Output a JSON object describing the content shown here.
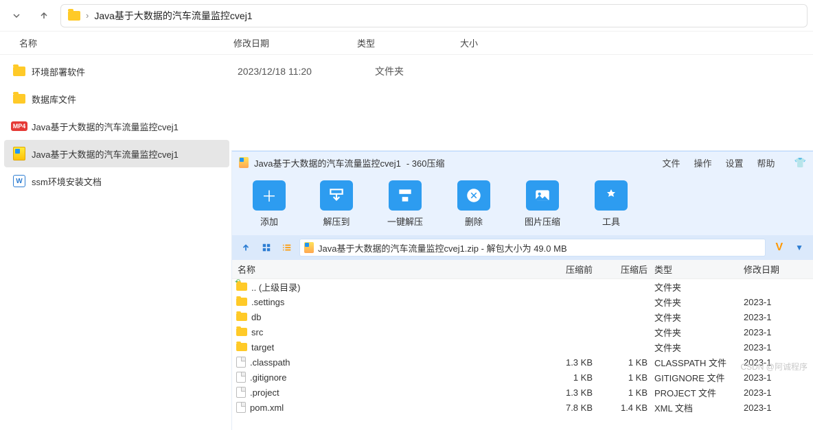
{
  "nav": {
    "path_label": "Java基于大数据的汽车流量监控cvej1"
  },
  "columns": {
    "name": "名称",
    "modified": "修改日期",
    "type": "类型",
    "size": "大小"
  },
  "explorer_rows": [
    {
      "icon": "folder",
      "name": "环境部署软件",
      "date": "2023/12/18 11:20",
      "ftype": "文件夹"
    },
    {
      "icon": "folder",
      "name": "数据库文件"
    },
    {
      "icon": "mp4",
      "name": "Java基于大数据的汽车流量监控cvej1"
    },
    {
      "icon": "zip",
      "name": "Java基于大数据的汽车流量监控cvej1",
      "selected": true
    },
    {
      "icon": "doc",
      "name": "ssm环境安装文档"
    }
  ],
  "zip": {
    "title_prefix": "Java基于大数据的汽车流量监控cvej1",
    "title_suffix": " - 360压缩",
    "menu": {
      "file": "文件",
      "op": "操作",
      "settings": "设置",
      "help": "帮助"
    },
    "toolbar": {
      "add": "添加",
      "extract": "解压到",
      "oneclick": "一键解压",
      "delete": "删除",
      "image": "图片压缩",
      "tools": "工具"
    },
    "path_text": "Java基于大数据的汽车流量监控cvej1.zip - 解包大小为 49.0 MB",
    "headers": {
      "name": "名称",
      "pre": "压缩前",
      "post": "压缩后",
      "type": "类型",
      "date": "修改日期"
    },
    "rows": [
      {
        "icon": "up",
        "name": ".. (上级目录)",
        "pre": "",
        "post": "",
        "type": "文件夹",
        "date": ""
      },
      {
        "icon": "folder",
        "name": ".settings",
        "pre": "",
        "post": "",
        "type": "文件夹",
        "date": "2023-1"
      },
      {
        "icon": "folder",
        "name": "db",
        "pre": "",
        "post": "",
        "type": "文件夹",
        "date": "2023-1"
      },
      {
        "icon": "folder",
        "name": "src",
        "pre": "",
        "post": "",
        "type": "文件夹",
        "date": "2023-1"
      },
      {
        "icon": "folder",
        "name": "target",
        "pre": "",
        "post": "",
        "type": "文件夹",
        "date": "2023-1"
      },
      {
        "icon": "file",
        "name": ".classpath",
        "pre": "1.3 KB",
        "post": "1 KB",
        "type": "CLASSPATH 文件",
        "date": "2023-1"
      },
      {
        "icon": "file",
        "name": ".gitignore",
        "pre": "1 KB",
        "post": "1 KB",
        "type": "GITIGNORE 文件",
        "date": "2023-1"
      },
      {
        "icon": "file",
        "name": ".project",
        "pre": "1.3 KB",
        "post": "1 KB",
        "type": "PROJECT 文件",
        "date": "2023-1"
      },
      {
        "icon": "file",
        "name": "pom.xml",
        "pre": "7.8 KB",
        "post": "1.4 KB",
        "type": "XML 文档",
        "date": "2023-1"
      }
    ]
  },
  "watermark": "CSDN @阿诚程序"
}
